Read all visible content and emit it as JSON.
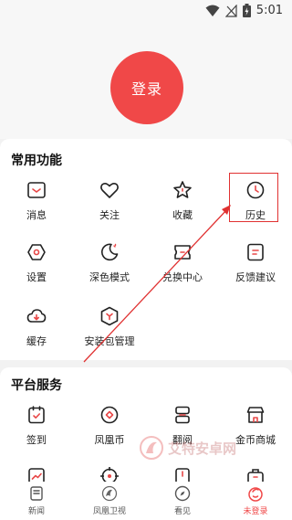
{
  "status_bar": {
    "time": "5:01",
    "wifi_icon": "wifi-icon",
    "signal_icon": "signal-icon",
    "battery_icon": "battery-icon"
  },
  "login": {
    "label": "登录"
  },
  "common": {
    "title": "常用功能",
    "items": [
      {
        "label": "消息",
        "icon": "message-icon"
      },
      {
        "label": "关注",
        "icon": "heart-icon"
      },
      {
        "label": "收藏",
        "icon": "star-icon"
      },
      {
        "label": "历史",
        "icon": "clock-icon"
      },
      {
        "label": "设置",
        "icon": "settings-icon"
      },
      {
        "label": "深色模式",
        "icon": "moon-icon"
      },
      {
        "label": "兑换中心",
        "icon": "ticket-icon"
      },
      {
        "label": "反馈建议",
        "icon": "feedback-icon"
      },
      {
        "label": "缓存",
        "icon": "download-icon"
      },
      {
        "label": "安装包管理",
        "icon": "package-icon"
      }
    ]
  },
  "platform": {
    "title": "平台服务",
    "items": [
      {
        "label": "签到",
        "icon": "checkin-icon"
      },
      {
        "label": "凤凰币",
        "icon": "coin-icon"
      },
      {
        "label": "翻阅",
        "icon": "flip-icon"
      },
      {
        "label": "金币商城",
        "icon": "shop-icon"
      }
    ]
  },
  "watermark": {
    "text": "艾特安卓网"
  },
  "nav": {
    "items": [
      {
        "label": "新闻",
        "icon": "news-icon",
        "active": false
      },
      {
        "label": "凤凰卫视",
        "icon": "phoenix-icon",
        "active": false
      },
      {
        "label": "看见",
        "icon": "compass-icon",
        "active": false
      },
      {
        "label": "未登录",
        "icon": "user-icon",
        "active": true
      }
    ]
  },
  "colors": {
    "accent": "#f04848",
    "annotation": "#e03131"
  }
}
